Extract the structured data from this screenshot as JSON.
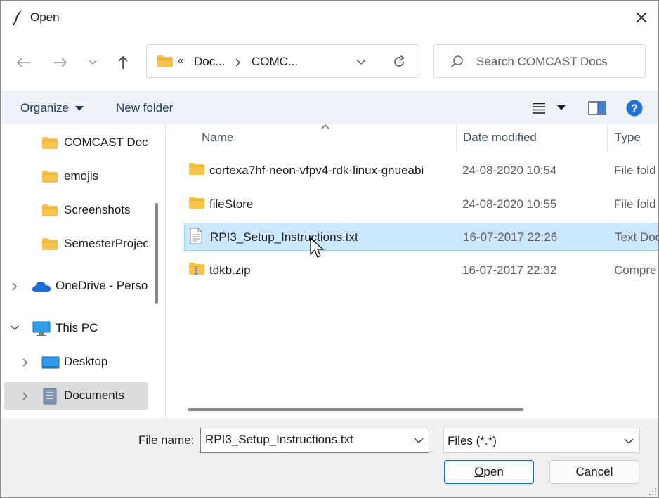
{
  "window": {
    "title": "Open"
  },
  "nav": {
    "breadcrumb_prefix": "«",
    "crumbs": [
      "Doc...",
      "COMC..."
    ],
    "search_placeholder": "Search COMCAST Docs"
  },
  "commandbar": {
    "organize": "Organize",
    "new_folder": "New folder"
  },
  "sidebar": {
    "items": [
      {
        "label": "COMCAST Doc"
      },
      {
        "label": "emojis"
      },
      {
        "label": "Screenshots"
      },
      {
        "label": "SemesterProjec"
      },
      {
        "label": "OneDrive - Perso"
      },
      {
        "label": "This PC"
      },
      {
        "label": "Desktop"
      },
      {
        "label": "Documents"
      }
    ]
  },
  "columns": {
    "name": "Name",
    "date": "Date modified",
    "type": "Type"
  },
  "files": [
    {
      "name": "cortexa7hf-neon-vfpv4-rdk-linux-gnueabi",
      "date": "24-08-2020 10:54",
      "type": "File fold",
      "icon": "folder-icon"
    },
    {
      "name": "fileStore",
      "date": "24-08-2020 10:55",
      "type": "File fold",
      "icon": "folder-icon"
    },
    {
      "name": "RPI3_Setup_Instructions.txt",
      "date": "16-07-2017 22:26",
      "type": "Text Doc",
      "icon": "text-file-icon"
    },
    {
      "name": "tdkb.zip",
      "date": "16-07-2017 22:32",
      "type": "Compre",
      "icon": "zip-folder-icon"
    }
  ],
  "bottom": {
    "filename_label_pre": "File ",
    "filename_label_accel": "n",
    "filename_label_post": "ame:",
    "filename_value": "RPI3_Setup_Instructions.txt",
    "filetype_value": "Files (*.*)",
    "open_accel": "O",
    "open_rest": "pen",
    "cancel_label": "Cancel"
  },
  "colors": {
    "selection_bg": "#cce8ff",
    "selection_border": "#99d1ff",
    "commandbar_bg": "#eef3f9",
    "help_blue": "#1f73d6",
    "folder_yellow": "#f7c34a"
  }
}
